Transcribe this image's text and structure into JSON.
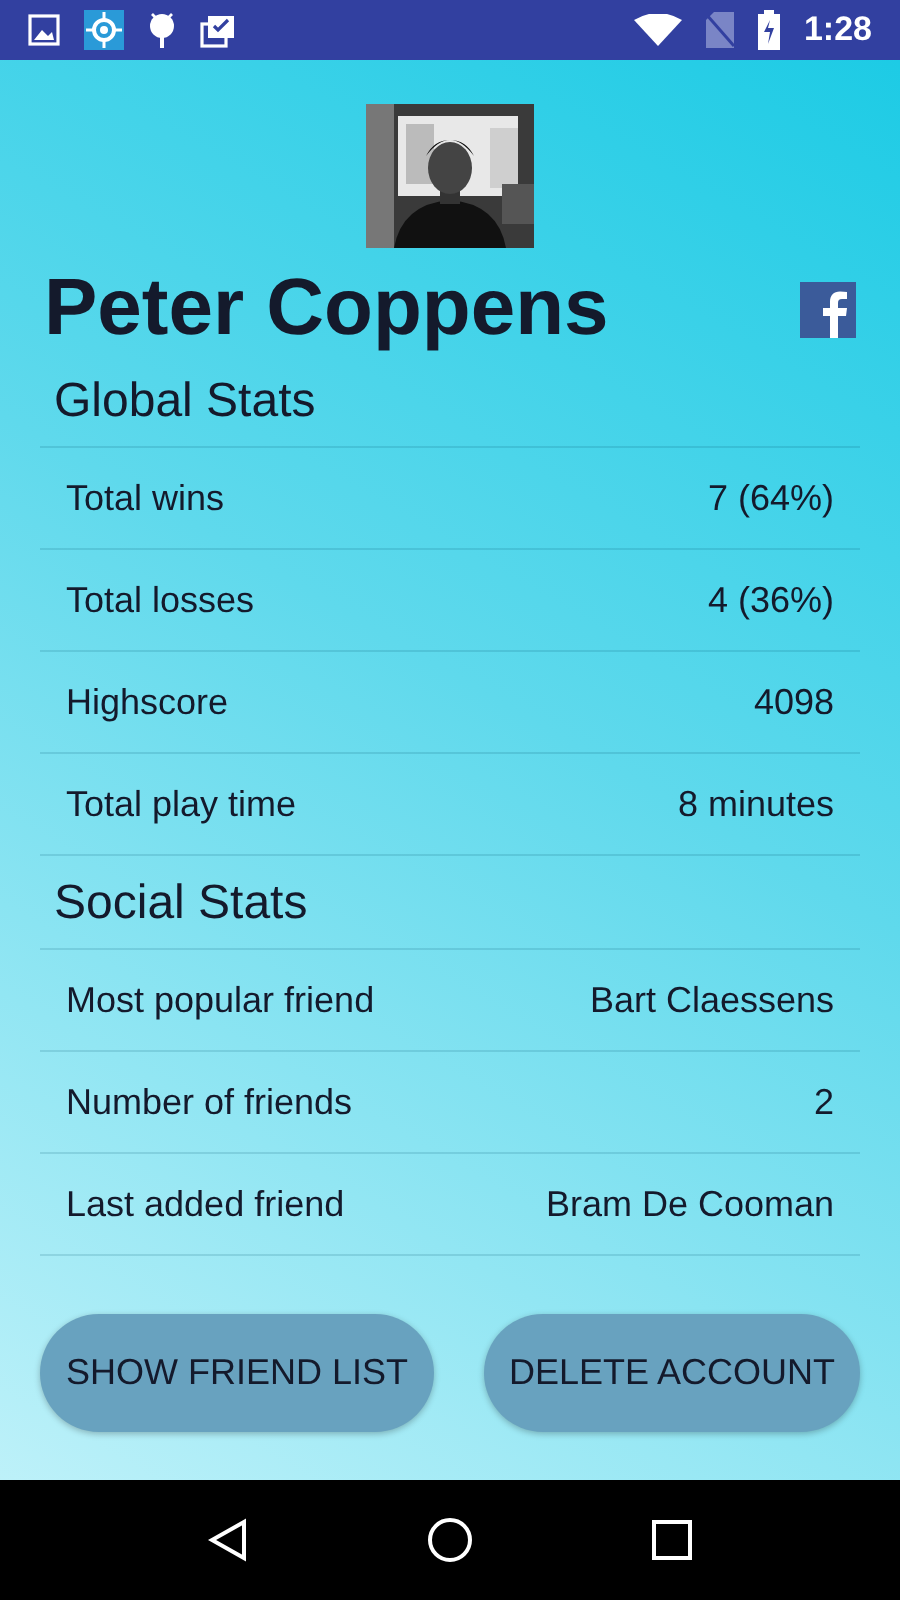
{
  "status_bar": {
    "time": "1:28"
  },
  "profile": {
    "name": "Peter Coppens"
  },
  "sections": [
    {
      "title": "Global Stats",
      "rows": [
        {
          "label": "Total wins",
          "value": "7 (64%)"
        },
        {
          "label": "Total losses",
          "value": "4 (36%)"
        },
        {
          "label": "Highscore",
          "value": "4098"
        },
        {
          "label": "Total play time",
          "value": "8 minutes"
        }
      ]
    },
    {
      "title": "Social Stats",
      "rows": [
        {
          "label": "Most popular friend",
          "value": "Bart Claessens"
        },
        {
          "label": "Number of friends",
          "value": "2"
        },
        {
          "label": "Last added friend",
          "value": "Bram De Cooman"
        }
      ]
    }
  ],
  "buttons": [
    "SHOW FRIEND LIST",
    "DELETE ACCOUNT"
  ]
}
